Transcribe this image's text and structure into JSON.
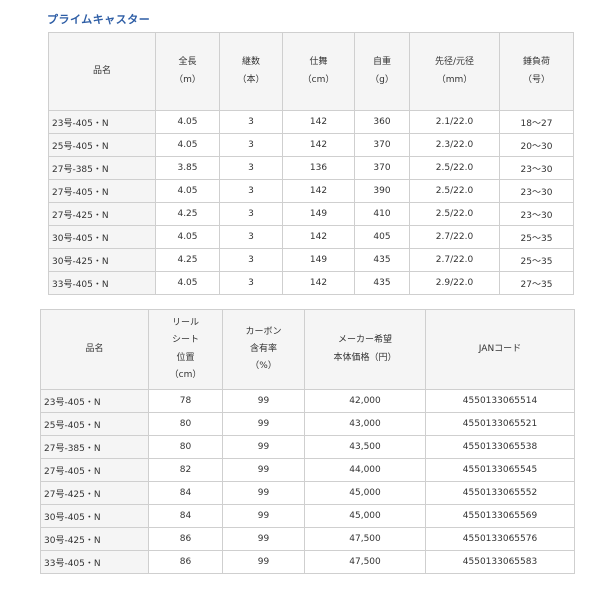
{
  "title": "プライムキャスター",
  "table1": {
    "headers": [
      [
        "品名"
      ],
      [
        "全長",
        "（m）"
      ],
      [
        "継数",
        "（本）"
      ],
      [
        "仕舞",
        "（cm）"
      ],
      [
        "自重",
        "（g）"
      ],
      [
        "先径/元径",
        "（mm）"
      ],
      [
        "錘負荷",
        "（号）"
      ]
    ],
    "rows": [
      [
        "23号-405・N",
        "4.05",
        "3",
        "142",
        "360",
        "2.1/22.0",
        "18～27"
      ],
      [
        "25号-405・N",
        "4.05",
        "3",
        "142",
        "370",
        "2.3/22.0",
        "20～30"
      ],
      [
        "27号-385・N",
        "3.85",
        "3",
        "136",
        "370",
        "2.5/22.0",
        "23～30"
      ],
      [
        "27号-405・N",
        "4.05",
        "3",
        "142",
        "390",
        "2.5/22.0",
        "23～30"
      ],
      [
        "27号-425・N",
        "4.25",
        "3",
        "149",
        "410",
        "2.5/22.0",
        "23～30"
      ],
      [
        "30号-405・N",
        "4.05",
        "3",
        "142",
        "405",
        "2.7/22.0",
        "25～35"
      ],
      [
        "30号-425・N",
        "4.25",
        "3",
        "149",
        "435",
        "2.7/22.0",
        "25～35"
      ],
      [
        "33号-405・N",
        "4.05",
        "3",
        "142",
        "435",
        "2.9/22.0",
        "27～35"
      ]
    ]
  },
  "table2": {
    "headers": [
      [
        "品名"
      ],
      [
        "リール",
        "シート",
        "位置",
        "（cm）"
      ],
      [
        "カーボン",
        "含有率",
        "（%）"
      ],
      [
        "メーカー希望",
        "本体価格（円）"
      ],
      [
        "JANコード"
      ]
    ],
    "rows": [
      [
        "23号-405・N",
        "78",
        "99",
        "42,000",
        "4550133065514"
      ],
      [
        "25号-405・N",
        "80",
        "99",
        "43,000",
        "4550133065521"
      ],
      [
        "27号-385・N",
        "80",
        "99",
        "43,500",
        "4550133065538"
      ],
      [
        "27号-405・N",
        "82",
        "99",
        "44,000",
        "4550133065545"
      ],
      [
        "27号-425・N",
        "84",
        "99",
        "45,000",
        "4550133065552"
      ],
      [
        "30号-405・N",
        "84",
        "99",
        "45,000",
        "4550133065569"
      ],
      [
        "30号-425・N",
        "86",
        "99",
        "47,500",
        "4550133065576"
      ],
      [
        "33号-405・N",
        "86",
        "99",
        "47,500",
        "4550133065583"
      ]
    ]
  }
}
